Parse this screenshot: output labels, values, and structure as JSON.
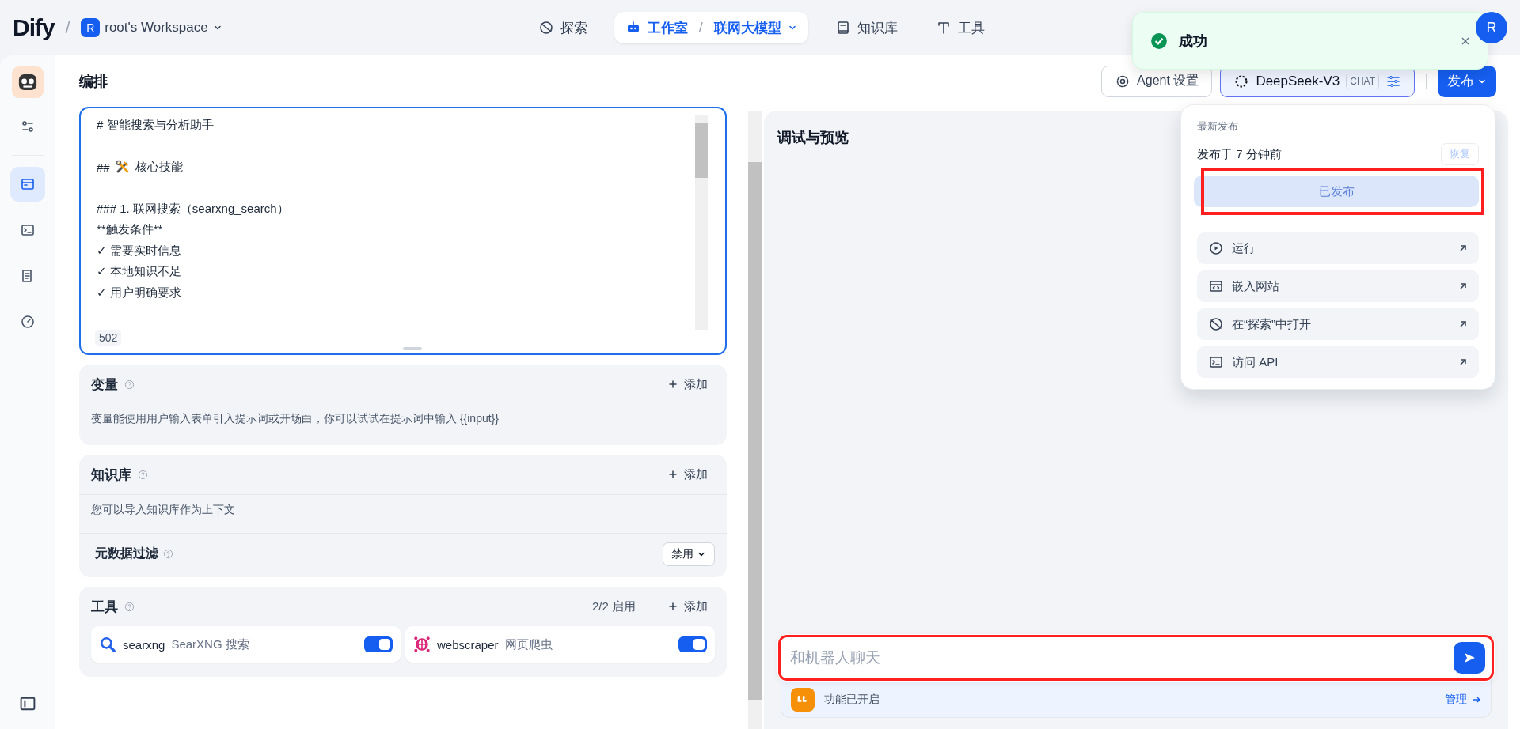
{
  "app": {
    "logo": "Dify",
    "separator": "/",
    "workspace": {
      "initial": "R",
      "name": "root's Workspace"
    }
  },
  "nav": [
    {
      "label": "探索",
      "selected": false
    },
    {
      "label": "工作室",
      "selected": true,
      "separator": "/",
      "app": "联网大模型"
    },
    {
      "label": "知识库",
      "selected": false
    },
    {
      "label": "工具",
      "selected": false
    }
  ],
  "toast": {
    "message": "成功",
    "kind": "success"
  },
  "user": {
    "initial": "R"
  },
  "sidebar": {
    "items": [
      {
        "selected": false
      },
      {
        "selected": true
      },
      {
        "selected": false
      },
      {
        "selected": false
      },
      {
        "selected": false
      }
    ]
  },
  "header": {
    "title": "编排",
    "agent_button": "Agent 设置",
    "model": {
      "name": "DeepSeek-V3",
      "badge": "CHAT"
    },
    "publish_button": "发布"
  },
  "prompt": {
    "lines": [
      {
        "kind": "text",
        "text": "# 智能搜索与分析助手"
      },
      {
        "kind": "blank"
      },
      {
        "kind": "icon",
        "prefix": "##",
        "text": "核心技能"
      },
      {
        "kind": "blank"
      },
      {
        "kind": "text",
        "text": "### 1. 联网搜索（searxng_search）"
      },
      {
        "kind": "text",
        "text": "**触发条件**"
      },
      {
        "kind": "text",
        "text": "✓ 需要实时信息"
      },
      {
        "kind": "text",
        "text": "✓ 本地知识不足"
      },
      {
        "kind": "text",
        "text": "✓ 用户明确要求"
      }
    ],
    "count": "502"
  },
  "variables": {
    "title": "变量",
    "add": "添加",
    "description": "变量能使用用户输入表单引入提示词或开场白，你可以试试在提示词中输入 {{input}}"
  },
  "knowledge": {
    "title": "知识库",
    "add": "添加",
    "description": "您可以导入知识库作为上下文",
    "filter": {
      "label": "元数据过滤",
      "value": "禁用"
    }
  },
  "tools": {
    "title": "工具",
    "count": "2/2 启用",
    "add": "添加",
    "items": [
      {
        "name": "searxng",
        "label": "SearXNG 搜索",
        "on": true
      },
      {
        "name": "webscraper",
        "label": "网页爬虫",
        "on": true
      }
    ]
  },
  "preview": {
    "title": "调试与预览",
    "placeholder": "和机器人聊天",
    "highlighted": true,
    "features": {
      "text": "功能已开启",
      "link": "管理"
    }
  },
  "publish_menu": {
    "heading": "最新发布",
    "time": "发布于 7 分钟前",
    "restore": "恢复",
    "published_button": "已发布",
    "published_disabled": true,
    "highlighted": true,
    "items": [
      {
        "label": "运行"
      },
      {
        "label": "嵌入网站"
      },
      {
        "label": "在“探索”中打开"
      },
      {
        "label": "访问 API"
      }
    ]
  }
}
